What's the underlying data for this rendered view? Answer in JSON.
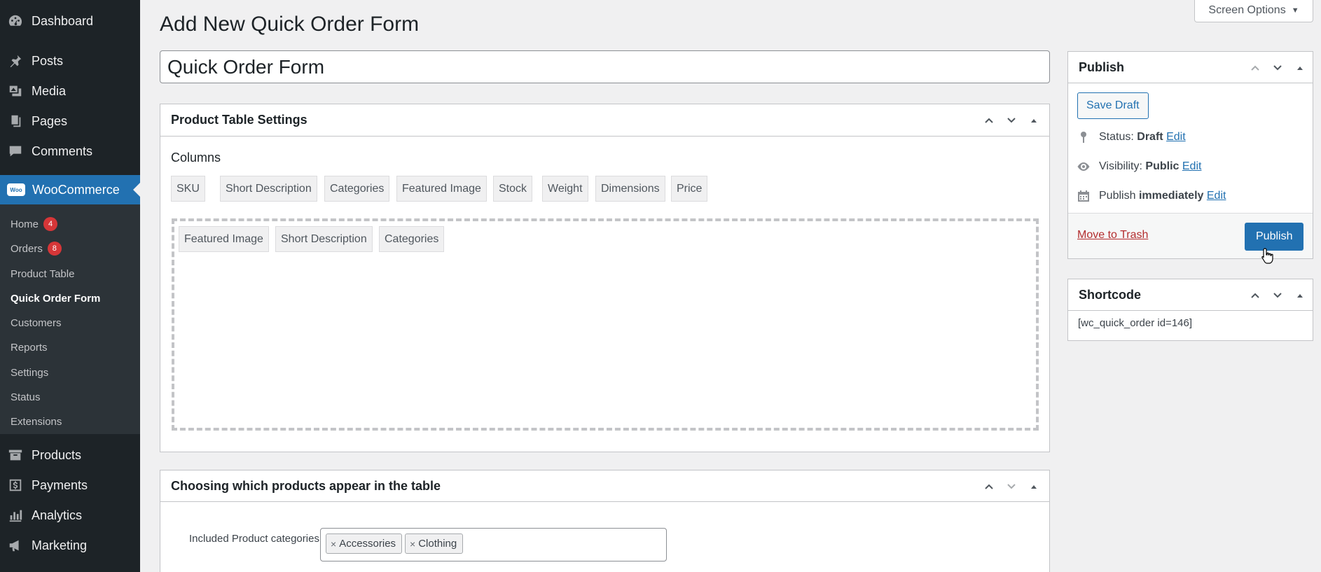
{
  "sidebar": {
    "top_items": [
      {
        "label": "Dashboard",
        "icon": "dashboard-icon"
      },
      {
        "label": "Posts",
        "icon": "pushpin-icon"
      },
      {
        "label": "Media",
        "icon": "media-icon"
      },
      {
        "label": "Pages",
        "icon": "pages-icon"
      },
      {
        "label": "Comments",
        "icon": "comment-icon"
      }
    ],
    "woocommerce": {
      "label": "WooCommerce",
      "logo_text": "Woo",
      "submenu": [
        {
          "label": "Home",
          "badge": "4"
        },
        {
          "label": "Orders",
          "badge": "8"
        },
        {
          "label": "Product Table"
        },
        {
          "label": "Quick Order Form",
          "current": true
        },
        {
          "label": "Customers"
        },
        {
          "label": "Reports"
        },
        {
          "label": "Settings"
        },
        {
          "label": "Status"
        },
        {
          "label": "Extensions"
        }
      ]
    },
    "bottom_items": [
      {
        "label": "Products",
        "icon": "archive-icon"
      },
      {
        "label": "Payments",
        "icon": "dollar-icon"
      },
      {
        "label": "Analytics",
        "icon": "bar-chart-icon"
      },
      {
        "label": "Marketing",
        "icon": "megaphone-icon"
      }
    ]
  },
  "header": {
    "screen_options": "Screen Options",
    "page_title": "Add New Quick Order Form"
  },
  "title_input": {
    "value": "Quick Order Form"
  },
  "product_table_settings": {
    "title": "Product Table Settings",
    "columns_label": "Columns",
    "available_columns": [
      "SKU",
      "Short Description",
      "Categories",
      "Featured Image",
      "Stock",
      "Weight",
      "Dimensions",
      "Price"
    ],
    "selected_columns": [
      "Featured Image",
      "Short Description",
      "Categories"
    ]
  },
  "choosing_products": {
    "title": "Choosing which products appear in the table",
    "included_label": "Included Product categories",
    "included_categories": [
      "Accessories",
      "Clothing"
    ]
  },
  "publish_box": {
    "title": "Publish",
    "save_draft": "Save Draft",
    "status_label": "Status:",
    "status_value": "Draft",
    "visibility_label": "Visibility:",
    "visibility_value": "Public",
    "publish_label": "Publish",
    "publish_value": "immediately",
    "edit_link": "Edit",
    "move_to_trash": "Move to Trash",
    "publish_button": "Publish"
  },
  "shortcode_box": {
    "title": "Shortcode",
    "value": "[wc_quick_order id=146]"
  },
  "colors": {
    "sidebar_bg": "#1d2327",
    "accent": "#2271b1",
    "badge": "#d63638",
    "trash": "#b32d2e"
  }
}
